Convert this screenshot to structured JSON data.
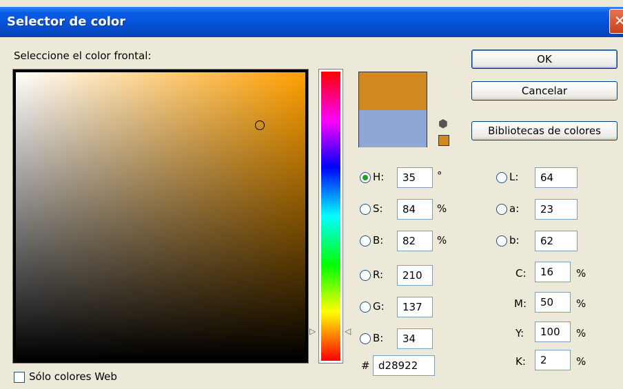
{
  "window": {
    "title": "Selector de color",
    "close_glyph": "✕"
  },
  "prompt_label": "Seleccione el color frontal:",
  "buttons": {
    "ok": "OK",
    "cancel": "Cancelar",
    "libraries": "Bibliotecas de colores"
  },
  "colors": {
    "new_color": "#d28922",
    "old_color": "#8fa7d6",
    "hue_marker_color": "#ffa000"
  },
  "icons": {
    "gamut": "cube-icon",
    "hue_arrow": "▷",
    "hue_arrow_r": "◁"
  },
  "hsb": {
    "h": {
      "label": "H:",
      "value": "35",
      "unit": "°",
      "selected": true
    },
    "s": {
      "label": "S:",
      "value": "84",
      "unit": "%"
    },
    "b": {
      "label": "B:",
      "value": "82",
      "unit": "%"
    }
  },
  "rgb": {
    "r": {
      "label": "R:",
      "value": "210"
    },
    "g": {
      "label": "G:",
      "value": "137"
    },
    "b": {
      "label": "B:",
      "value": "34"
    }
  },
  "lab": {
    "l": {
      "label": "L:",
      "value": "64"
    },
    "a": {
      "label": "a:",
      "value": "23"
    },
    "b": {
      "label": "b:",
      "value": "62"
    }
  },
  "cmyk": {
    "c": {
      "label": "C:",
      "value": "16",
      "unit": "%"
    },
    "m": {
      "label": "M:",
      "value": "50",
      "unit": "%"
    },
    "y": {
      "label": "Y:",
      "value": "100",
      "unit": "%"
    },
    "k": {
      "label": "K:",
      "value": "2",
      "unit": "%"
    }
  },
  "hex": {
    "label": "#",
    "value": "d28922"
  },
  "web_only": {
    "label": "Sólo colores Web",
    "checked": false
  }
}
